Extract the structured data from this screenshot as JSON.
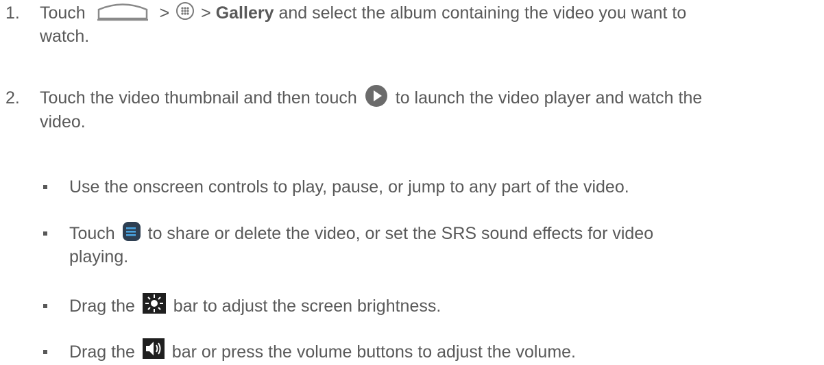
{
  "steps": [
    {
      "number": "1.",
      "line1_a": "Touch",
      "sep1": ">",
      "sep2": ">",
      "bold": "Gallery",
      "line1_b": "and select the album containing the video you want to",
      "line2": "watch.",
      "icons": [
        "home-icon",
        "apps-icon"
      ]
    },
    {
      "number": "2.",
      "line1_a": "Touch the video thumbnail and then touch",
      "line1_b": "to launch the video player and watch the",
      "line2": "video.",
      "icons": [
        "play-icon"
      ]
    }
  ],
  "bullets": [
    {
      "text": "Use the onscreen controls to play, pause, or jump to any part of the video."
    },
    {
      "text_a": "Touch",
      "text_b": "to share or delete the video, or set the SRS sound effects for video",
      "line2": "playing.",
      "icon": "menu-icon"
    },
    {
      "text_a": "Drag the",
      "text_b": "bar to adjust the screen brightness.",
      "icon": "brightness-icon"
    },
    {
      "text_a": "Drag the",
      "text_b": "bar or press the volume buttons to adjust the volume.",
      "icon": "volume-icon"
    }
  ],
  "colors": {
    "text": "#595959",
    "play_icon": "#6b6b6b",
    "menu_icon_bg": "#2e3f52",
    "menu_icon_lines": "#4aa3df"
  }
}
